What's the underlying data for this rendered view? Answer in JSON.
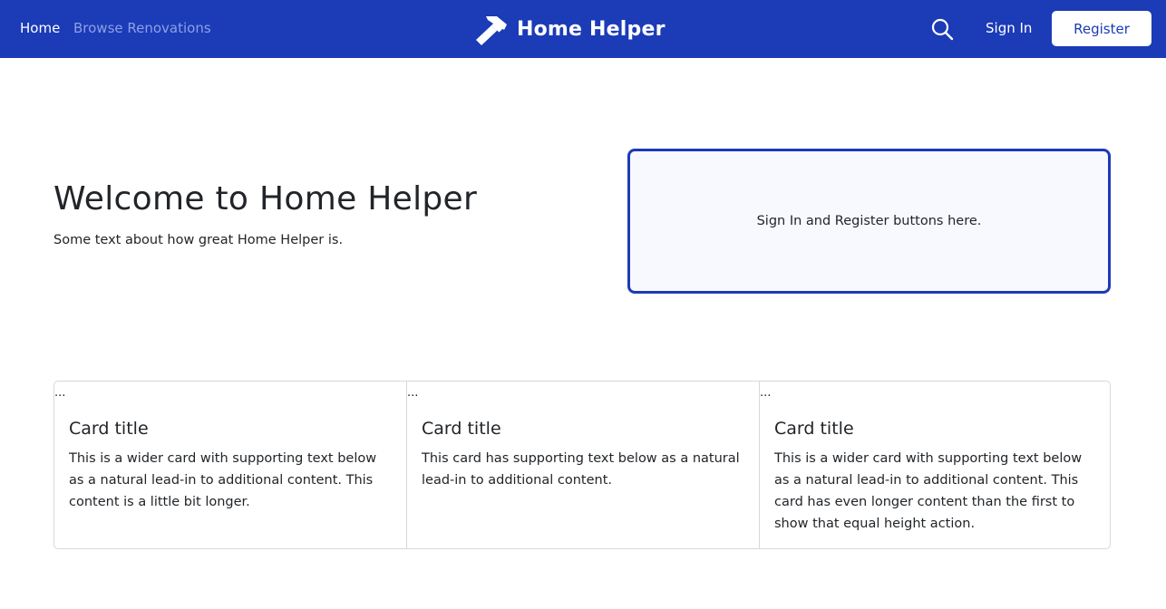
{
  "nav": {
    "home": "Home",
    "browse": "Browse Renovations",
    "brand": "Home Helper",
    "brand_icon": "hammer-icon",
    "search_icon": "search-icon",
    "sign_in": "Sign In",
    "register": "Register"
  },
  "colors": {
    "navbar": "#1b3bb7",
    "muted_link": "#8ea0e6",
    "auth_border": "#1b3bb7",
    "auth_bg": "#f8f9fe"
  },
  "hero": {
    "title": "Welcome to Home Helper",
    "text": "Some text about how great Home Helper is."
  },
  "auth_box": {
    "text": "Sign In and Register buttons here."
  },
  "cards": [
    {
      "image_alt": "...",
      "title": "Card title",
      "text": "This is a wider card with supporting text below as a natural lead-in to additional content. This content is a little bit longer."
    },
    {
      "image_alt": "...",
      "title": "Card title",
      "text": "This card has supporting text below as a natural lead-in to additional content."
    },
    {
      "image_alt": "...",
      "title": "Card title",
      "text": "This is a wider card with supporting text below as a natural lead-in to additional content. This card has even longer content than the first to show that equal height action."
    }
  ]
}
